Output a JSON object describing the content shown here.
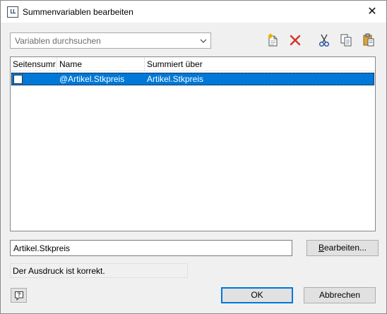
{
  "window": {
    "title": "Summenvariablen bearbeiten",
    "app_icon_text": "LL",
    "close_glyph": "✕"
  },
  "search": {
    "placeholder": "Variablen durchsuchen"
  },
  "toolbar": {
    "icons": [
      "new-variable-icon",
      "delete-icon",
      "cut-icon",
      "copy-icon",
      "paste-icon"
    ],
    "delete_color": "#d0362a"
  },
  "table": {
    "columns": [
      "Seitensumr",
      "Name",
      "Summiert über"
    ],
    "rows": [
      {
        "page_sum": false,
        "name": "@Artikel.Stkpreis",
        "summed_over": "Artikel.Stkpreis",
        "selected": true
      }
    ],
    "selection_color": "#0078d7"
  },
  "expression": {
    "value": "Artikel.Stkpreis"
  },
  "buttons": {
    "edit_first": "B",
    "edit_rest": "earbeiten...",
    "ok": "OK",
    "cancel": "Abbrechen"
  },
  "status": {
    "text": "Der Ausdruck ist korrekt."
  }
}
